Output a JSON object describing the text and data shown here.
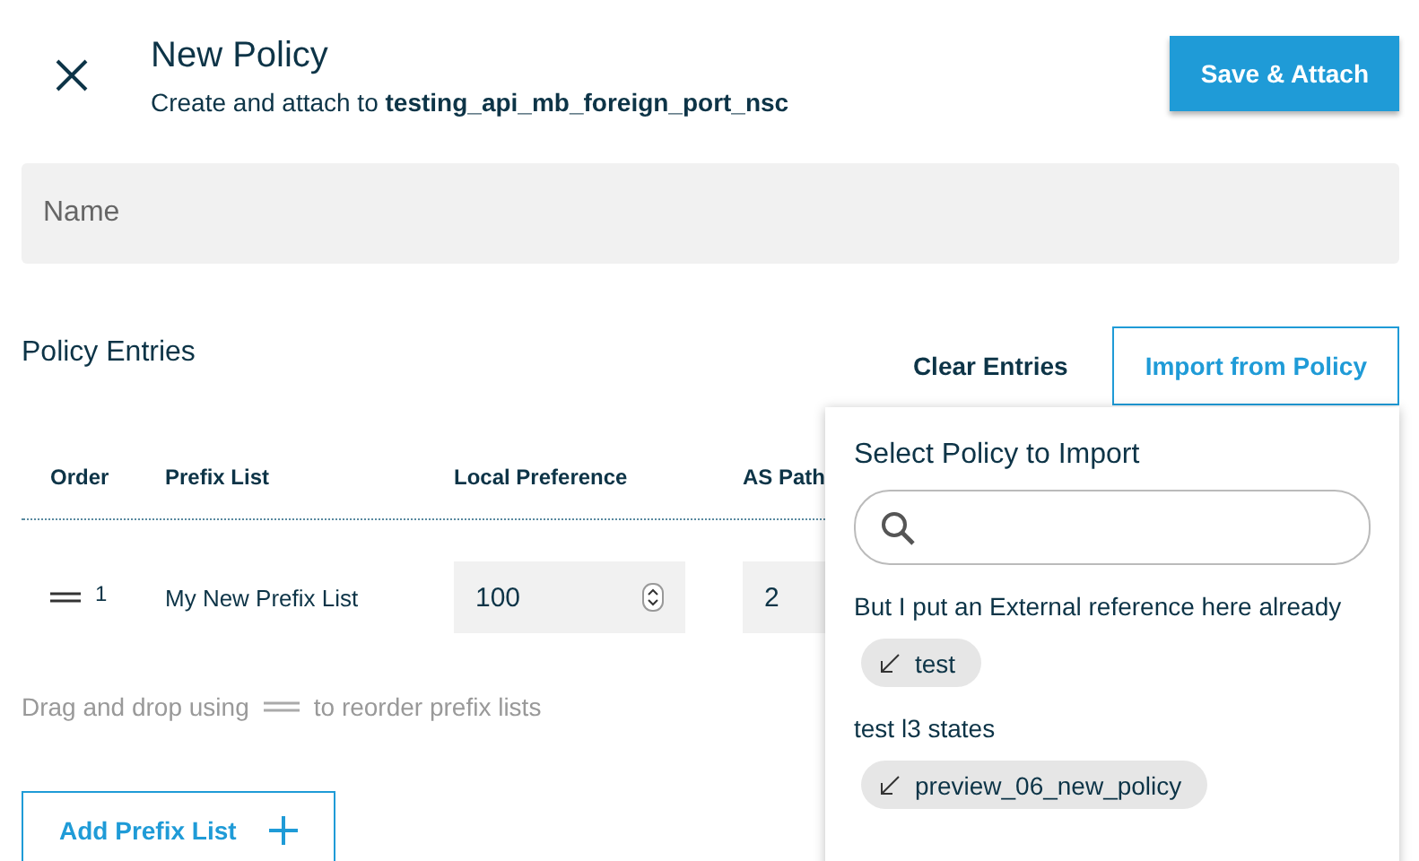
{
  "header": {
    "title": "New Policy",
    "subtitle": "Create and attach to **testing_api_mb_foreign_port_nsc**",
    "primary_button": "Save & Attach"
  },
  "name_field": {
    "placeholder": "Name"
  },
  "entries": {
    "title": "Policy Entries",
    "clear_button": "Clear Entries",
    "import_button": "Import from Policy",
    "columns": [
      "Order",
      "Prefix List",
      "Local Preference",
      "AS Path"
    ],
    "rows": [
      {
        "order": "1",
        "prefix_list": "My New Prefix List",
        "local_preference": "100",
        "as_path": "2"
      }
    ],
    "hint_before": "Drag and drop using",
    "hint_after": "to reorder prefix lists",
    "add_button": "Add Prefix List"
  },
  "import_panel": {
    "title": "Select Policy to Import",
    "groups": [
      {
        "label": "But I put an External reference here already",
        "policies": [
          "test"
        ]
      },
      {
        "label": "test l3 states",
        "policies": [
          "preview_06_new_policy"
        ]
      }
    ]
  }
}
